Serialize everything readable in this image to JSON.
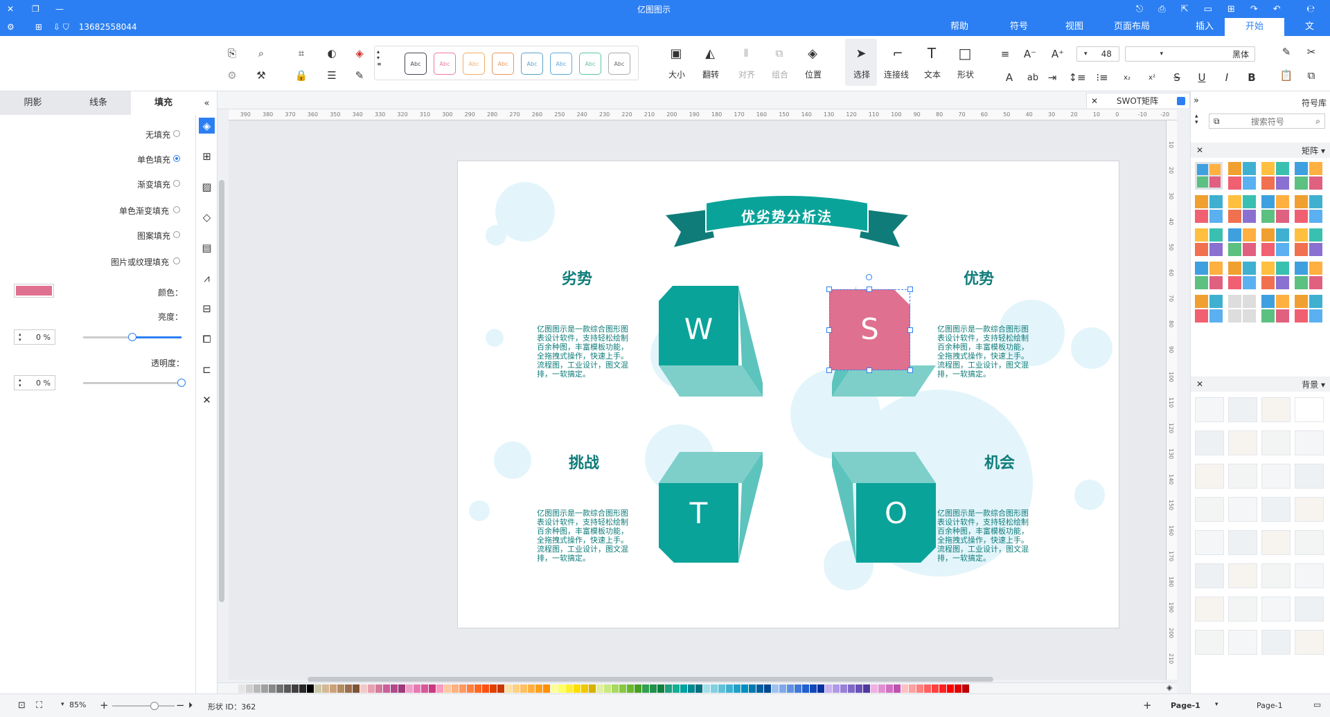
{
  "app": {
    "title": "亿图图示",
    "user": "13682558044"
  },
  "menu_tabs": [
    {
      "label": "文件",
      "active": false
    },
    {
      "label": "开始",
      "active": true
    },
    {
      "label": "插入",
      "active": false
    },
    {
      "label": "页面布局",
      "active": false
    },
    {
      "label": "视图",
      "active": false
    },
    {
      "label": "符号",
      "active": false
    },
    {
      "label": "帮助",
      "active": false
    }
  ],
  "ribbon": {
    "font_name": "黑体",
    "font_size": "48",
    "style_sample": "Abc",
    "labels": {
      "select": "选择",
      "connector": "连接线",
      "text": "文本",
      "shape": "形状",
      "size": "大小",
      "flip": "翻转",
      "align": "对齐",
      "group": "组合",
      "position": "位置"
    }
  },
  "left_panel": {
    "tabs": [
      {
        "label": "填充",
        "active": true
      },
      {
        "label": "线条",
        "active": false
      },
      {
        "label": "阴影",
        "active": false
      }
    ],
    "fill_options": [
      {
        "label": "无填充",
        "selected": false
      },
      {
        "label": "单色填充",
        "selected": true
      },
      {
        "label": "渐变填充",
        "selected": false
      },
      {
        "label": "单色渐变填充",
        "selected": false
      },
      {
        "label": "图案填充",
        "selected": false
      },
      {
        "label": "图片或纹理填充",
        "selected": false
      }
    ],
    "color_label": "颜色：",
    "color_value": "#e0708f",
    "brightness_label": "亮度：",
    "brightness_value": "0 %",
    "brightness_level": 0.5,
    "transparency_label": "透明度：",
    "transparency_value": "0 %",
    "transparency_level": 0
  },
  "document": {
    "tab_name": "SWOT矩阵",
    "title": "优劣势分析法",
    "quadrants": {
      "strength": {
        "letter": "S",
        "heading": "优势"
      },
      "weakness": {
        "letter": "W",
        "heading": "劣势"
      },
      "opportunity": {
        "letter": "O",
        "heading": "机会"
      },
      "threat": {
        "letter": "T",
        "heading": "挑战"
      }
    },
    "body_text": "亿图图示是一款综合图形图表设计软件，支持轻松绘制百余种图，丰富模板功能，全拖拽式操作，快速上手。流程图，工业设计，图文混排，一软搞定。",
    "ruler_labels": [
      "-20",
      "-10",
      "0",
      "10",
      "20",
      "30",
      "40",
      "50",
      "60",
      "70",
      "80",
      "90",
      "100",
      "110",
      "120",
      "130",
      "140",
      "150",
      "160",
      "170",
      "180",
      "190",
      "200",
      "210",
      "220",
      "230",
      "240",
      "250",
      "260",
      "270",
      "280",
      "290",
      "300",
      "310",
      "320",
      "330",
      "340",
      "350",
      "360",
      "370",
      "380",
      "390"
    ],
    "vruler_labels": [
      "10",
      "20",
      "30",
      "40",
      "50",
      "60",
      "70",
      "80",
      "90",
      "100",
      "110",
      "120",
      "130",
      "140",
      "150",
      "160",
      "170",
      "180",
      "190",
      "200",
      "210"
    ]
  },
  "right_panel": {
    "title": "符号库",
    "search_placeholder": "搜索符号",
    "section_matrix": "矩阵",
    "section_background": "背景"
  },
  "status": {
    "page_select": "Page-1",
    "page_tab": "Page-1",
    "shape_id": "形状 ID：362",
    "zoom": "85%"
  },
  "colors": {
    "accent": "#2c7ff2",
    "teal": "#0aa39a",
    "teal_dark": "#0f7c7a",
    "teal_light": "#5dc3bd",
    "pink": "#e0708f"
  },
  "palette": [
    "#e6e6e6",
    "#d0d0d0",
    "#b8b8b8",
    "#a0a0a0",
    "#888888",
    "#707070",
    "#585858",
    "#404040",
    "#282828",
    "#000000",
    "#c8c8a8",
    "#d4b896",
    "#c9a27a",
    "#b58b62",
    "#9c6e4a",
    "#7d5336",
    "#f2c8c8",
    "#e8a0b0",
    "#d47a9a",
    "#c9609a",
    "#b04a8a",
    "#9c3a7a",
    "#f0a0c8",
    "#e878b0",
    "#d8589a",
    "#c83a80",
    "#ff9ac0",
    "#ffc8a0",
    "#ffb080",
    "#ff9860",
    "#ff8040",
    "#ff6820",
    "#ff5010",
    "#e04000",
    "#c83800",
    "#ffe0a0",
    "#ffd080",
    "#ffc060",
    "#ffb040",
    "#ffa020",
    "#ff9000",
    "#ffff99",
    "#ffff66",
    "#ffee33",
    "#ffdd00",
    "#f0c800",
    "#d8b000",
    "#e0f0a0",
    "#c8e880",
    "#a8d860",
    "#88c840",
    "#68b830",
    "#48a020",
    "#30a050",
    "#20904a",
    "#108040",
    "#20a080",
    "#10b090",
    "#00a0a0",
    "#008890",
    "#007080",
    "#a0e0e8",
    "#80d0e0",
    "#60c0d8",
    "#40b0d0",
    "#20a0c8",
    "#0090c0",
    "#0078b0",
    "#0060a0",
    "#004890",
    "#a0c0f0",
    "#80a8e8",
    "#6090e0",
    "#4078d8",
    "#2060d0",
    "#1048b8",
    "#0830a0",
    "#c8b0f0",
    "#b098e8",
    "#9880d8",
    "#8068c8",
    "#6850b8",
    "#5038a0",
    "#f0b0e0",
    "#e090d0",
    "#d070c0",
    "#c050b0",
    "#ffc0c0",
    "#ffa0a0",
    "#ff8080",
    "#ff6060",
    "#ff4040",
    "#ff2020",
    "#ff0000",
    "#e00000",
    "#c00000"
  ]
}
